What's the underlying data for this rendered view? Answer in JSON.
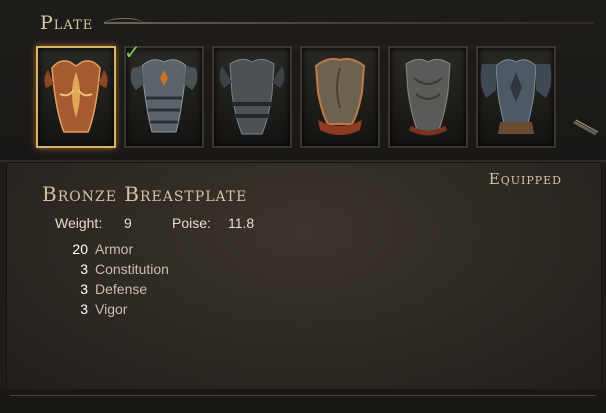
{
  "category": {
    "title": "Plate"
  },
  "equipment_slots": [
    {
      "name": "bronze-breastplate-slot",
      "icon": "bronze-breastplate-icon",
      "selected": true,
      "equipped": true,
      "tint": "#b86b3a"
    },
    {
      "name": "steel-plate-slot-2",
      "icon": "steel-plate-armor-icon",
      "selected": false,
      "tint": "#5b636b"
    },
    {
      "name": "steel-plate-slot-3",
      "icon": "iron-cuirass-icon",
      "selected": false,
      "tint": "#4c5156"
    },
    {
      "name": "steel-plate-slot-4",
      "icon": "bronze-trim-cuirass-icon",
      "selected": false,
      "tint": "#6e6251"
    },
    {
      "name": "steel-plate-slot-5",
      "icon": "engraved-cuirass-icon",
      "selected": false,
      "tint": "#5a5a58"
    },
    {
      "name": "steel-plate-slot-6",
      "icon": "blue-steel-plate-icon",
      "selected": false,
      "tint": "#4d5a66"
    }
  ],
  "details": {
    "status": "Equipped",
    "item_name": "Bronze Breastplate",
    "weight_label": "Weight:",
    "weight_value": "9",
    "poise_label": "Poise:",
    "poise_value": "11.8",
    "attributes": [
      {
        "value": "20",
        "name": "Armor"
      },
      {
        "value": "3",
        "name": "Constitution"
      },
      {
        "value": "3",
        "name": "Defense"
      },
      {
        "value": "3",
        "name": "Vigor"
      }
    ]
  },
  "colors": {
    "selected_border": "#d9b267",
    "check": "#7ecb63",
    "title": "#d6c2a0"
  }
}
